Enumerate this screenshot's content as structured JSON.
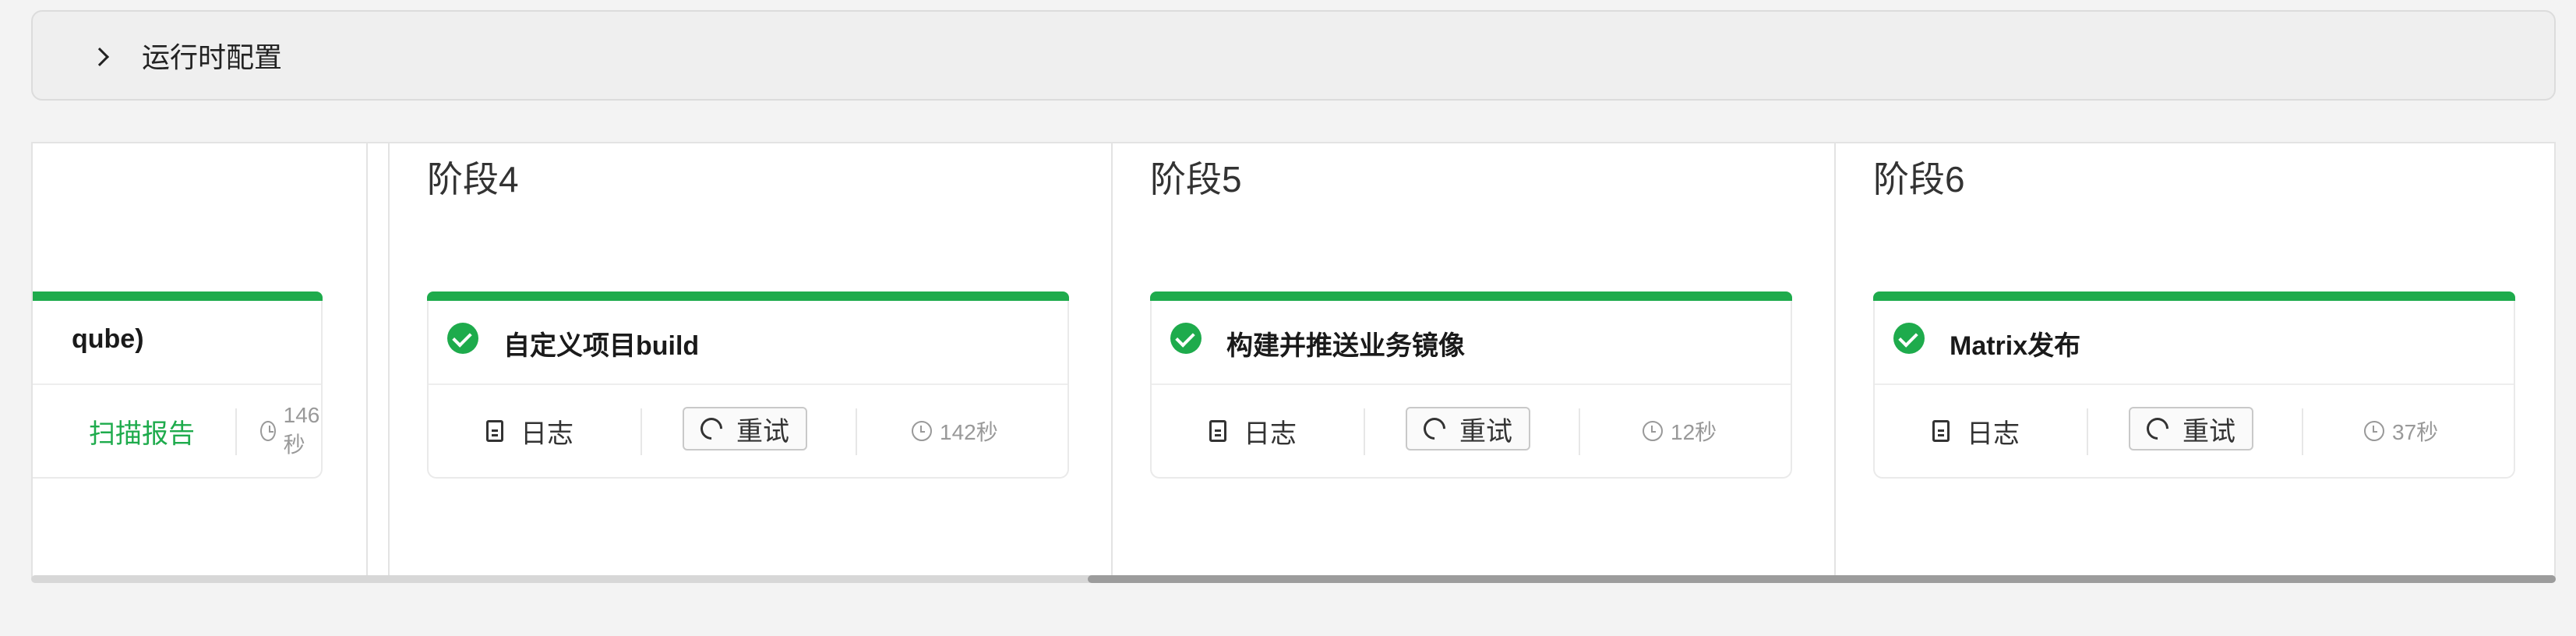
{
  "runtime_config": {
    "label": "运行时配置"
  },
  "partial_stage": {
    "job_name_fragment": "qube)",
    "report_label": "扫描报告",
    "duration": "146秒"
  },
  "stages": [
    {
      "title": "阶段4",
      "job": {
        "name": "自定义项目build",
        "log_label": "日志",
        "retry_label": "重试",
        "duration": "142秒"
      }
    },
    {
      "title": "阶段5",
      "job": {
        "name": "构建并推送业务镜像",
        "log_label": "日志",
        "retry_label": "重试",
        "duration": "12秒"
      }
    },
    {
      "title": "阶段6",
      "job": {
        "name": "Matrix发布",
        "log_label": "日志",
        "retry_label": "重试",
        "duration": "37秒"
      }
    }
  ],
  "colors": {
    "success": "#1eab4c",
    "background": "#f3f3f3"
  },
  "icons": [
    "chevron-right-icon",
    "check-circle-icon",
    "file-text-icon",
    "refresh-icon",
    "clock-icon"
  ]
}
